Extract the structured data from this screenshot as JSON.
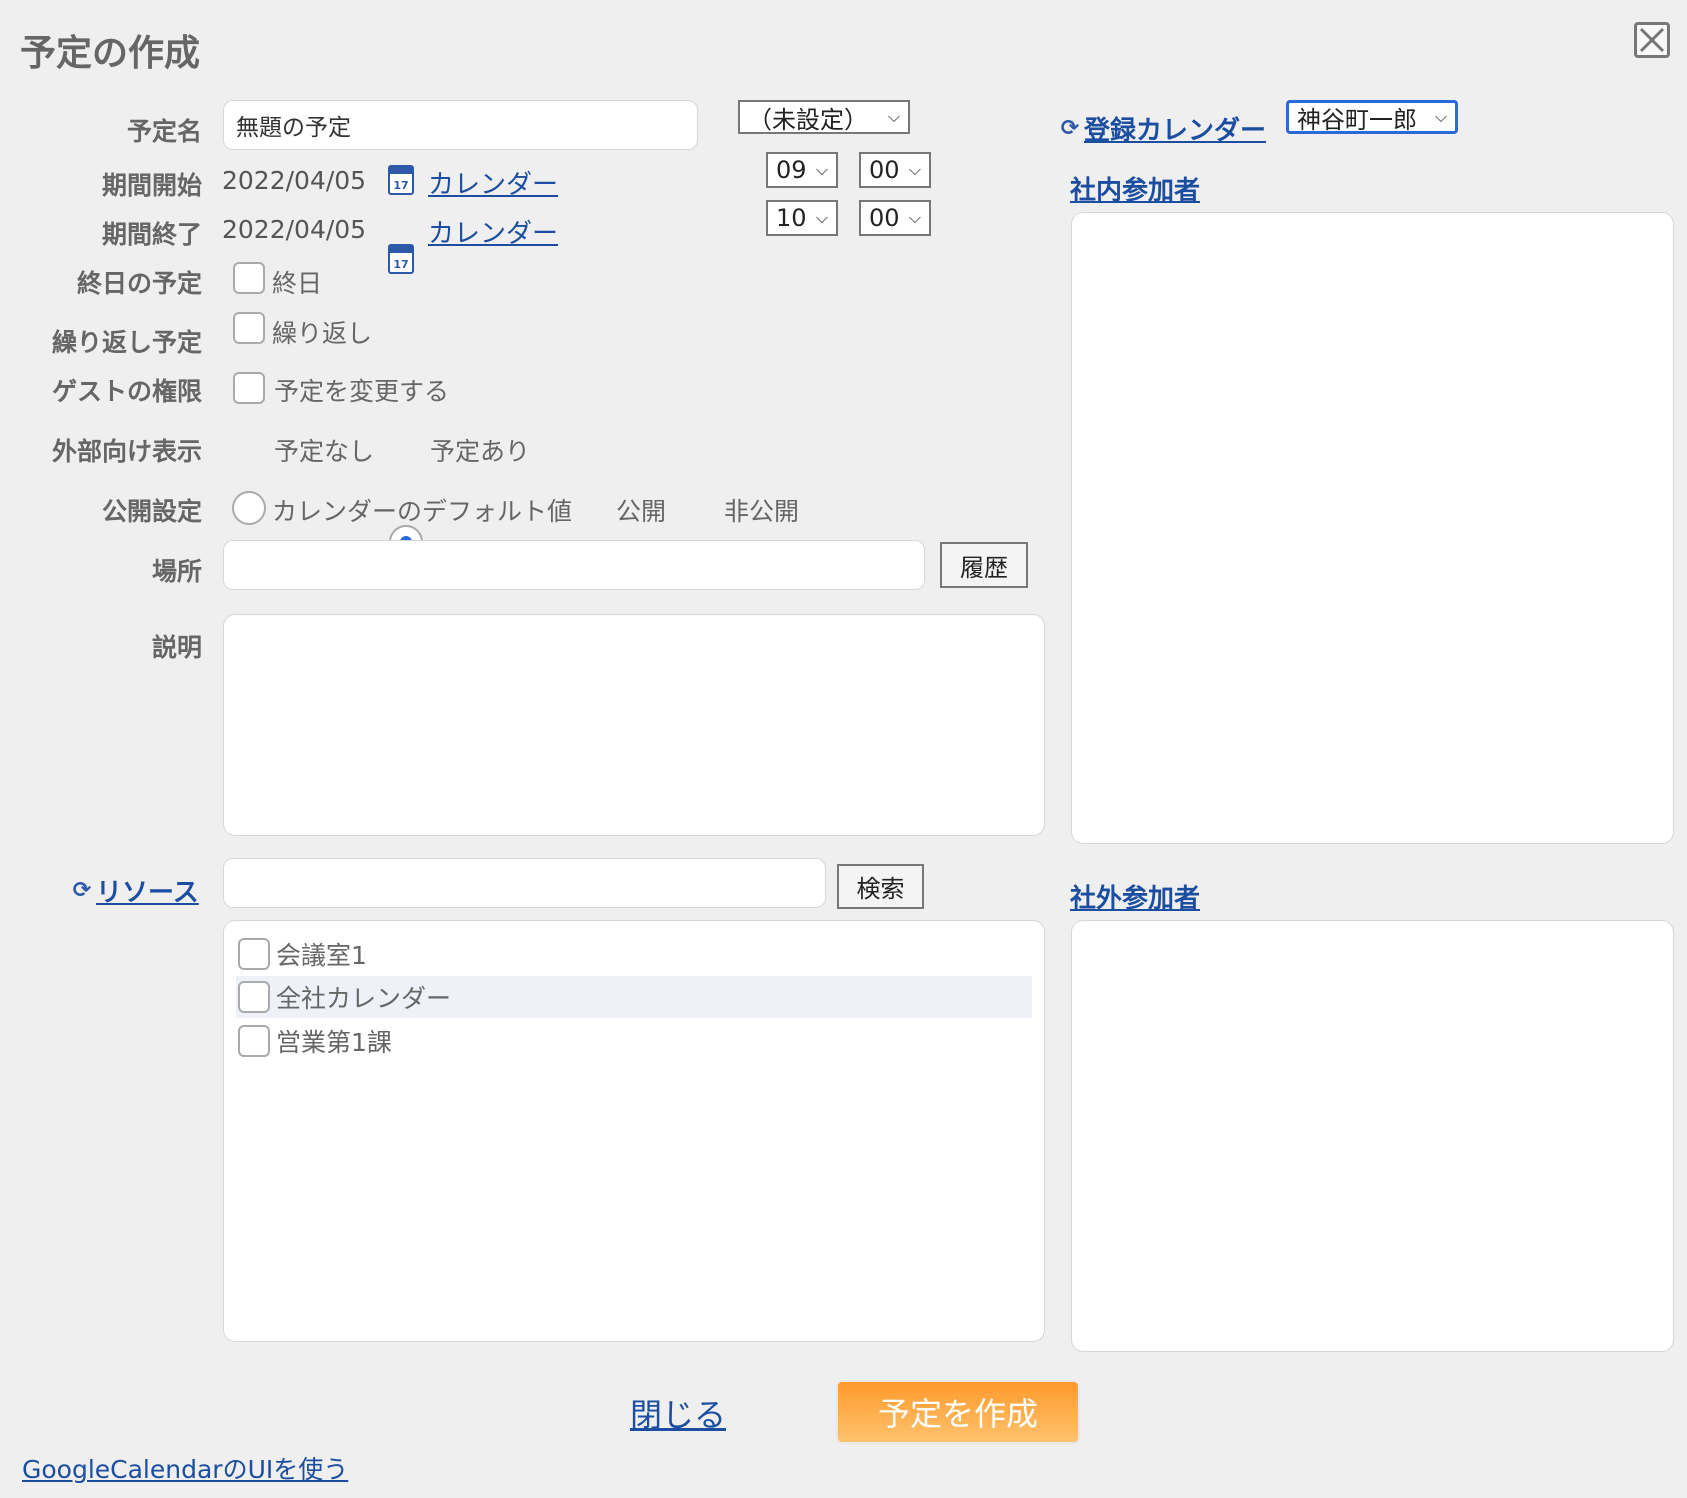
{
  "dialog": {
    "title": "予定の作成"
  },
  "labels": {
    "title": "予定名",
    "start": "期間開始",
    "end": "期間終了",
    "all_day": "終日の予定",
    "repeat": "繰り返し予定",
    "guest_perm": "ゲストの権限",
    "external_view": "外部向け表示",
    "visibility": "公開設定",
    "location": "場所",
    "description": "説明",
    "resource": "リソース"
  },
  "fields": {
    "title_value": "無題の予定",
    "category_select": "（未設定）",
    "start_date": "2022/04/05",
    "end_date": "2022/04/05",
    "calendar_link": "カレンダー",
    "calendar_icon_day": "17",
    "start_hour": "09",
    "start_min": "00",
    "end_hour": "10",
    "end_min": "00",
    "location_value": "",
    "description_value": "",
    "resource_search_value": ""
  },
  "checkboxes": {
    "all_day": "終日",
    "repeat": "繰り返し",
    "guest_modify": "予定を変更する"
  },
  "radios": {
    "external": [
      {
        "label": "予定なし",
        "checked": false
      },
      {
        "label": "予定あり",
        "checked": true
      }
    ],
    "visibility": [
      {
        "label": "カレンダーのデフォルト値",
        "checked": true
      },
      {
        "label": "公開",
        "checked": false
      },
      {
        "label": "非公開",
        "checked": false
      }
    ]
  },
  "buttons": {
    "history": "履歴",
    "search": "検索",
    "close_link": "閉じる",
    "create": "予定を作成",
    "google_ui_link": "GoogleCalendarのUIを使う"
  },
  "resources": [
    {
      "label": "会議室1",
      "checked": false
    },
    {
      "label": "全社カレンダー",
      "checked": false,
      "highlighted": true
    },
    {
      "label": "営業第1課",
      "checked": false
    }
  ],
  "right": {
    "register_calendar_link": "登録カレンダー",
    "register_calendar_value": "神谷町一郎",
    "internal_participants": "社内参加者",
    "external_participants": "社外参加者"
  },
  "colors": {
    "link": "#1b4ea0",
    "accent": "#ff9a2c",
    "radio_dot": "#2a6ad8"
  },
  "icons": {
    "close": "close-x-icon",
    "calendar": "calendar-icon",
    "refresh": "refresh-icon",
    "chevron": "chevron-down-icon"
  }
}
